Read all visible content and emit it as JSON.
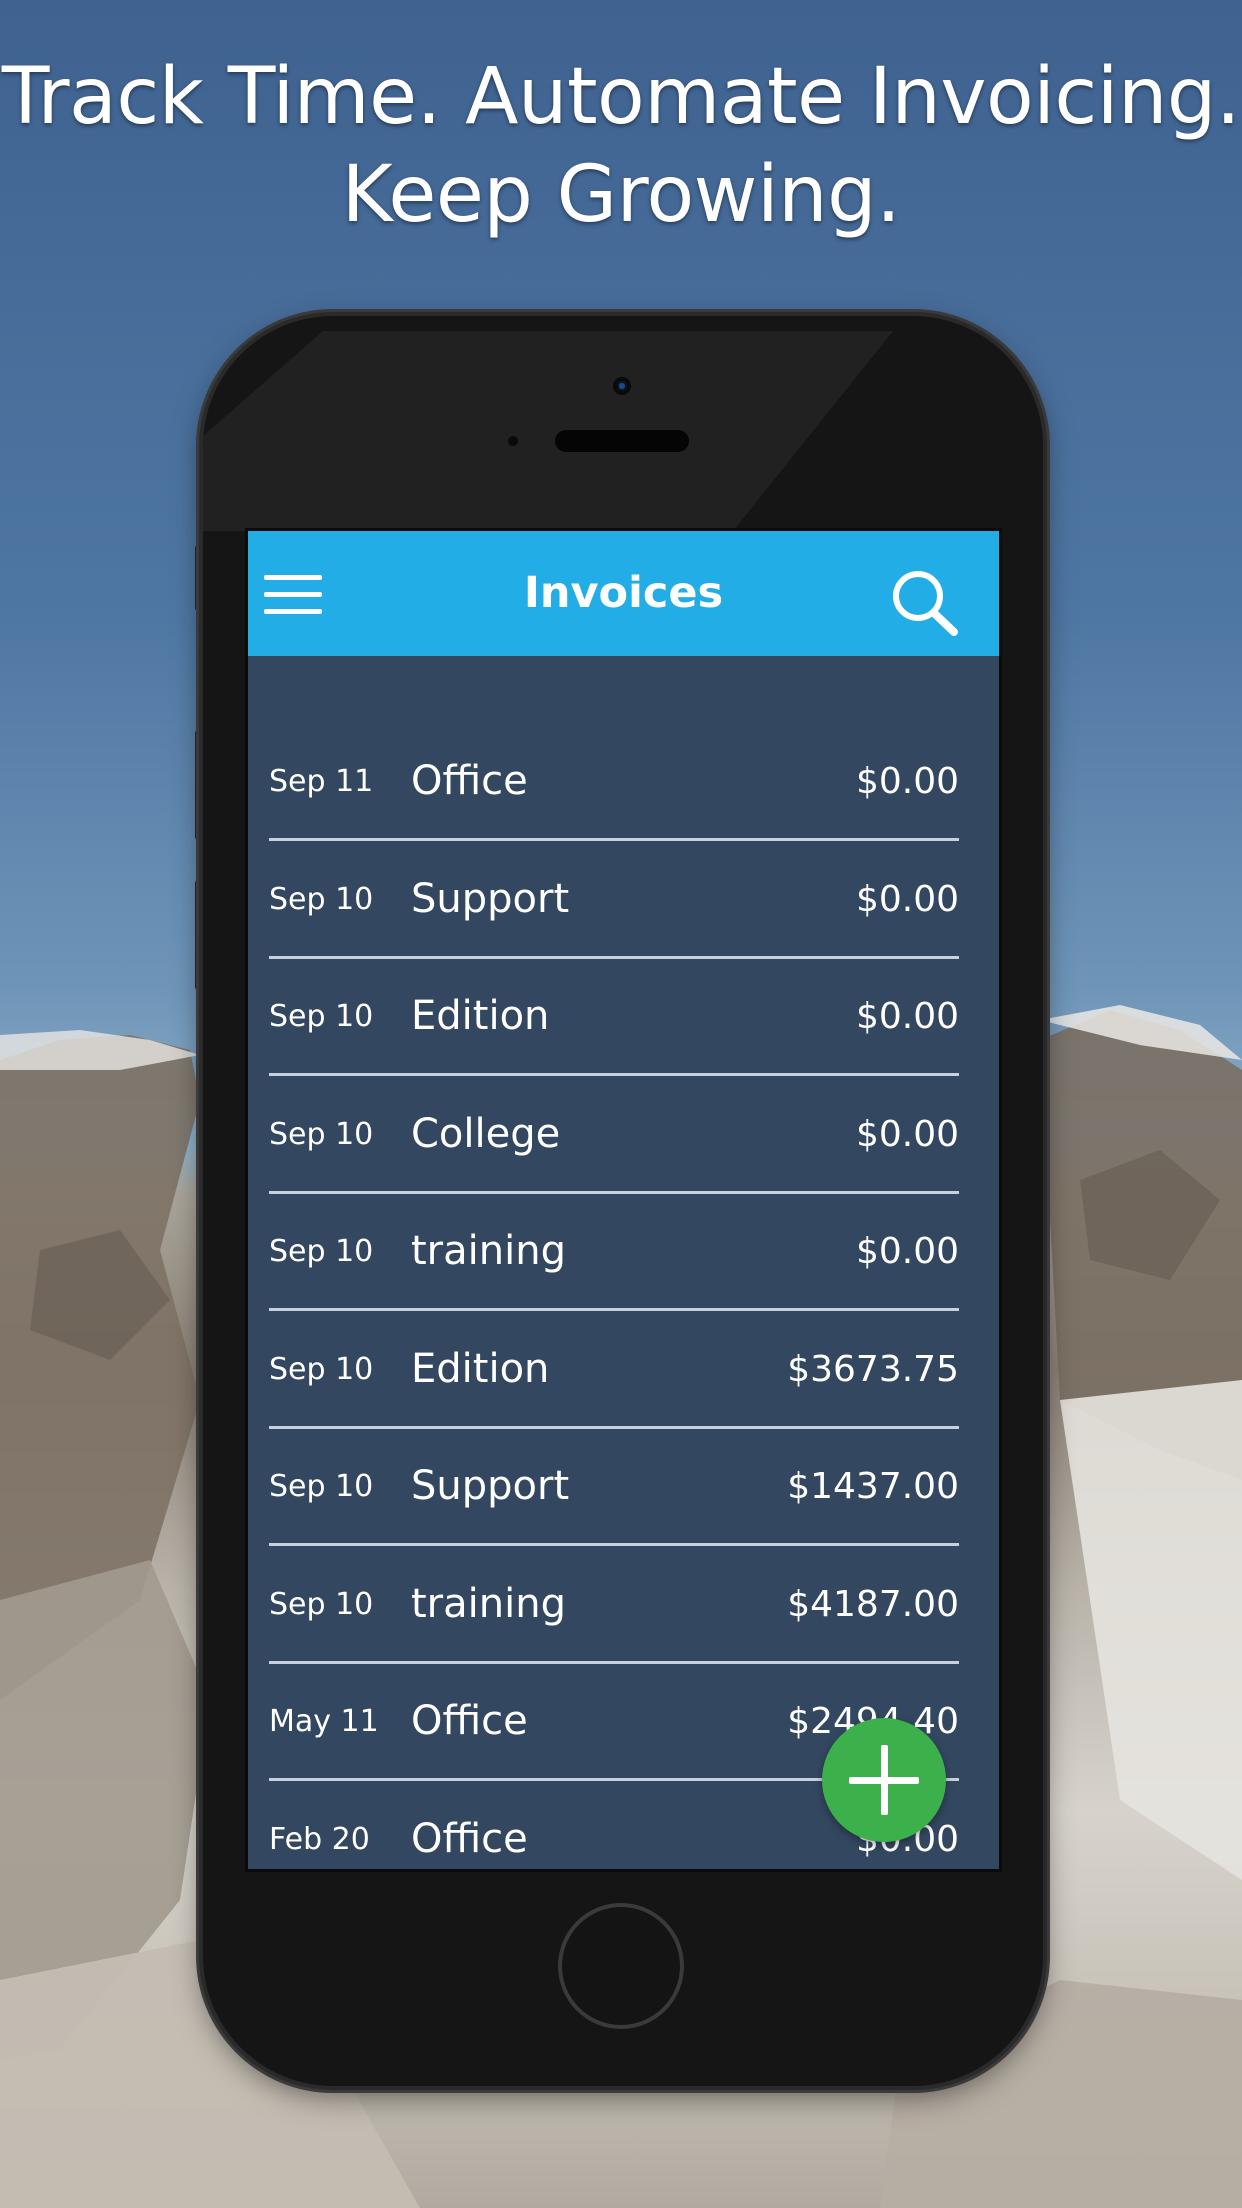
{
  "headline": {
    "line1": "Track Time. Automate Invoicing.",
    "line2": "Keep Growing."
  },
  "appbar": {
    "title": "Invoices",
    "menu_icon": "hamburger-menu-icon",
    "search_icon": "search-icon"
  },
  "invoices": [
    {
      "date": "Sep 11",
      "client": "Office",
      "amount": "$0.00"
    },
    {
      "date": "Sep 10",
      "client": "Support",
      "amount": "$0.00"
    },
    {
      "date": "Sep 10",
      "client": "Edition",
      "amount": "$0.00"
    },
    {
      "date": "Sep 10",
      "client": "College",
      "amount": "$0.00"
    },
    {
      "date": "Sep 10",
      "client": "training",
      "amount": "$0.00"
    },
    {
      "date": "Sep 10",
      "client": "Edition",
      "amount": "$3673.75"
    },
    {
      "date": "Sep 10",
      "client": "Support",
      "amount": "$1437.00"
    },
    {
      "date": "Sep 10",
      "client": "training",
      "amount": "$4187.00"
    },
    {
      "date": "May 11",
      "client": "Office",
      "amount": "$2494.40"
    },
    {
      "date": "Feb 20",
      "client": "Office",
      "amount": "$0.00"
    }
  ],
  "fab": {
    "icon": "plus-icon",
    "color": "#3cb04a"
  },
  "colors": {
    "appbar": "#23ade6",
    "list_background": "#334760",
    "divider": "#c9d1da"
  }
}
